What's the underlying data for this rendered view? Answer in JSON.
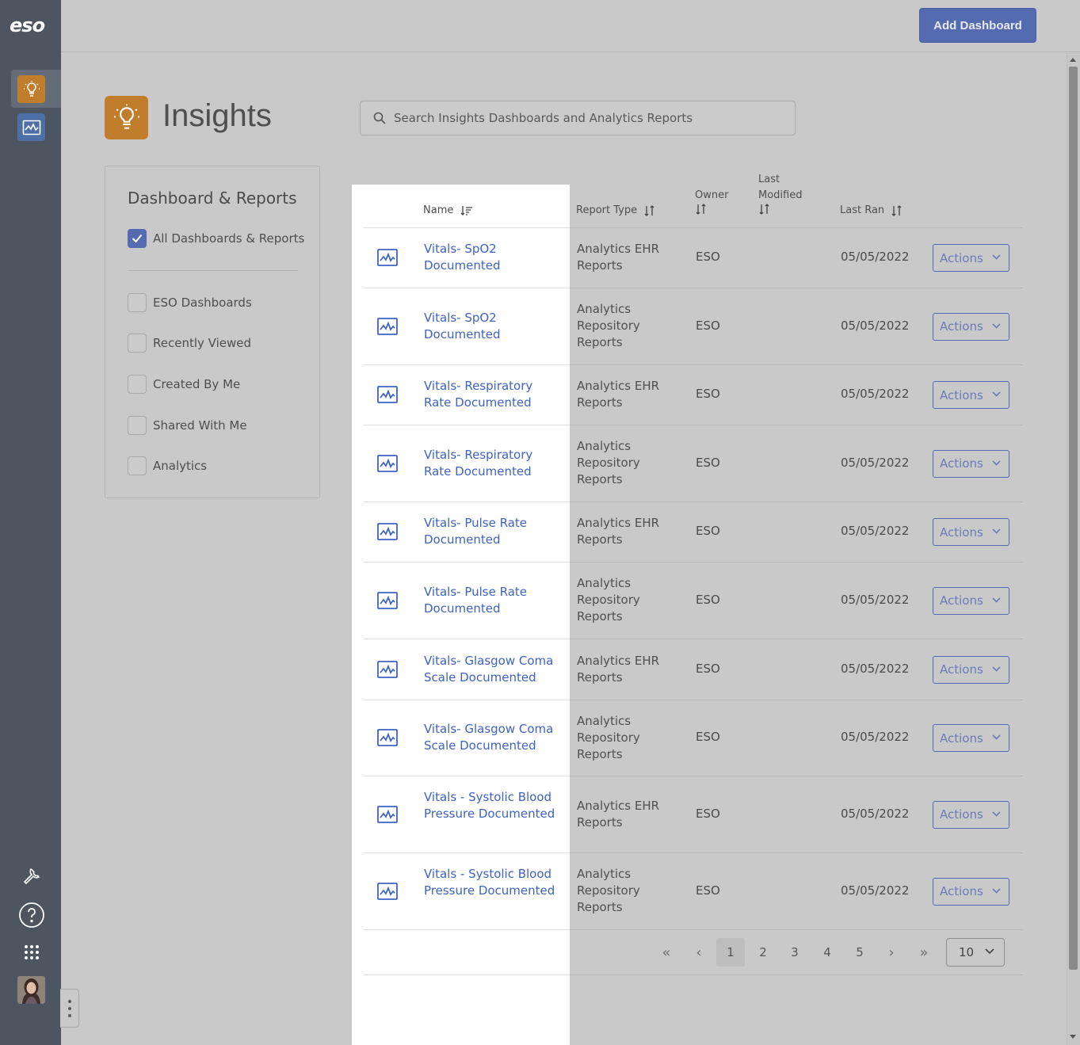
{
  "app": {
    "logo": "eso"
  },
  "topbar": {
    "add_dashboard_label": "Add Dashboard"
  },
  "page": {
    "title": "Insights"
  },
  "search": {
    "placeholder": "Search Insights Dashboards and Analytics Reports"
  },
  "filters": {
    "title": "Dashboard & Reports",
    "all": {
      "label": "All Dashboards & Reports",
      "checked": true
    },
    "items": [
      {
        "label": "ESO Dashboards",
        "checked": false
      },
      {
        "label": "Recently Viewed",
        "checked": false
      },
      {
        "label": "Created By Me",
        "checked": false
      },
      {
        "label": "Shared With Me",
        "checked": false
      },
      {
        "label": "Analytics",
        "checked": false
      }
    ]
  },
  "table": {
    "headers": {
      "name": "Name",
      "report_type": "Report Type",
      "owner": "Owner",
      "last_modified_1": "Last",
      "last_modified_2": "Modified",
      "last_ran": "Last Ran"
    },
    "actions_label": "Actions",
    "rows": [
      {
        "name": "Vitals- SpO2 Documented",
        "type": "Analytics EHR Reports",
        "owner": "ESO",
        "last_modified": "",
        "last_ran": "05/05/2022"
      },
      {
        "name": "Vitals- SpO2 Documented",
        "type": "Analytics Repository Reports",
        "owner": "ESO",
        "last_modified": "",
        "last_ran": "05/05/2022"
      },
      {
        "name": "Vitals- Respiratory Rate Documented",
        "type": "Analytics EHR Reports",
        "owner": "ESO",
        "last_modified": "",
        "last_ran": "05/05/2022"
      },
      {
        "name": "Vitals- Respiratory Rate Documented",
        "type": "Analytics Repository Reports",
        "owner": "ESO",
        "last_modified": "",
        "last_ran": "05/05/2022"
      },
      {
        "name": "Vitals- Pulse Rate Documented",
        "type": "Analytics EHR Reports",
        "owner": "ESO",
        "last_modified": "",
        "last_ran": "05/05/2022"
      },
      {
        "name": "Vitals- Pulse Rate Documented",
        "type": "Analytics Repository Reports",
        "owner": "ESO",
        "last_modified": "",
        "last_ran": "05/05/2022"
      },
      {
        "name": "Vitals- Glasgow Coma Scale Documented",
        "type": "Analytics EHR Reports",
        "owner": "ESO",
        "last_modified": "",
        "last_ran": "05/05/2022"
      },
      {
        "name": "Vitals- Glasgow Coma Scale Documented",
        "type": "Analytics Repository Reports",
        "owner": "ESO",
        "last_modified": "",
        "last_ran": "05/05/2022"
      },
      {
        "name": "Vitals - Systolic Blood Pressure Documented",
        "type": "Analytics EHR Reports",
        "owner": "ESO",
        "last_modified": "",
        "last_ran": "05/05/2022"
      },
      {
        "name": "Vitals - Systolic Blood Pressure Documented",
        "type": "Analytics Repository Reports",
        "owner": "ESO",
        "last_modified": "",
        "last_ran": "05/05/2022"
      }
    ]
  },
  "pagination": {
    "first": "«",
    "prev": "‹",
    "pages": [
      "1",
      "2",
      "3",
      "4",
      "5"
    ],
    "current": "1",
    "next": "›",
    "last": "»",
    "page_size": "10"
  },
  "colors": {
    "accent": "#546ab1",
    "insights": "#c07d2c",
    "link": "#3f63c4",
    "rail": "#4d5560"
  },
  "icons": [
    "lightbulb-icon",
    "analytics-chart-icon",
    "wrench-icon",
    "help-icon",
    "apps-grid-icon",
    "search-icon",
    "sort-icon",
    "chevron-down-icon",
    "report-chart-icon",
    "check-icon"
  ]
}
